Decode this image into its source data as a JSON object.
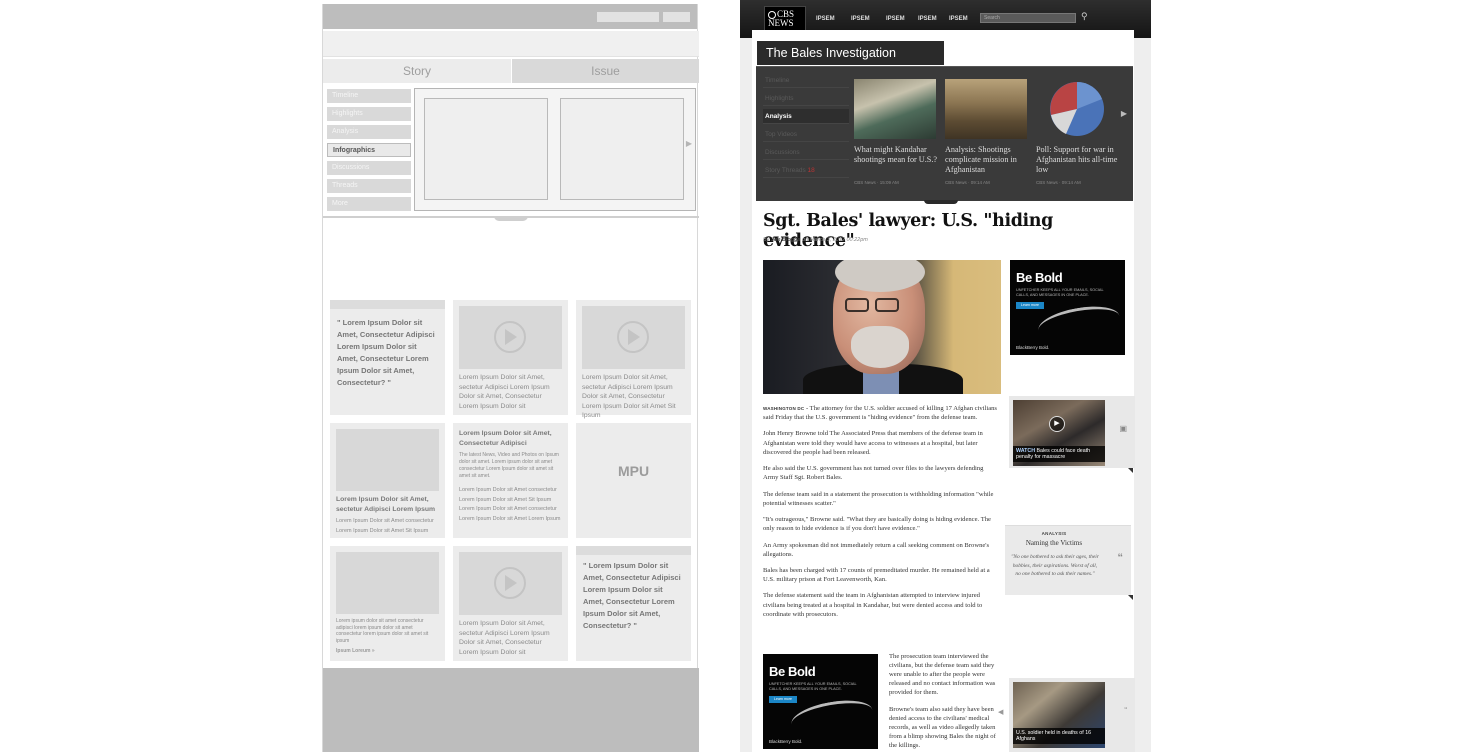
{
  "wireframe": {
    "tabs": [
      "Story",
      "Issue"
    ],
    "nav_items": [
      "Timeline",
      "Highlights",
      "Analysis",
      "Infographics",
      "Discussions",
      "Threads",
      "More"
    ],
    "active_nav": "Infographics",
    "cells": {
      "quote1": "\" Lorem Ipsum Dolor sit Amet, Consectetur Adipisci Lorem Ipsum Dolor sit Amet, Consectetur Lorem Ipsum Dolor sit Amet, Consectetur? \"",
      "video1_text": "Lorem Ipsum Dolor sit Amet, sectetur Adipisci Lorem Ipsum Dolor sit Amet, Consectetur Lorem Ipsum Dolor sit",
      "video2_text": "Lorem Ipsum Dolor sit Amet, sectetur Adipisci Lorem Ipsum Dolor sit Amet, Consectetur Lorem Ipsum Dolor sit Amet Sit Ipsum",
      "image1_title": "Lorem Ipsum Dolor sit Amet, sectetur Adipisci Lorem Ipsum",
      "image1_text": "Lorem Ipsum Dolor sit Amet consectetur Lorem Ipsum Dolor sit Amet Sit Ipsum",
      "article_title": "Lorem Ipsum Dolor sit Amet, Consectetur Adipisci",
      "article_intro": "The latest News, Video and Photos on Ipsum dolor sit amet. Lorem ipsum dolor sit amet consectetur Lorem Ipsum dolor sit amet sit amet sit amet.",
      "article_list": "Lorem Ipsum Dolor sit Amet consectetur Lorem Ipsum Dolor sit Amet Sit Ipsum Lorem Ipsum Dolor sit Amet consectetur Lorem Ipsum Dolor sit Amet Lorem Ipsum",
      "mpu": "MPU",
      "image2_text": "Lorem ipsum dolor sit amet consectetur adipisci lorem ipsum dolor sit amet consectetur lorem ipsum dolor sit amet sit ipsum",
      "image2_more": "Ipsum Loreum »",
      "video3_text": "Lorem Ipsum Dolor sit Amet, sectetur Adipisci Lorem Ipsum Dolor sit Amet, Consectetur Lorem Ipsum Dolor sit",
      "quote2": "\" Lorem Ipsum Dolor sit Amet, Consectetur Adipisci Lorem Ipsum Dolor sit Amet, Consectetur Lorem Ipsum Dolor sit Amet, Consectetur? \""
    }
  },
  "mockup": {
    "logo": "CBS NEWS",
    "nav": [
      "IPSEM",
      "IPSEM",
      "IPSEM",
      "IPSEM",
      "IPSEM"
    ],
    "search_placeholder": "Search",
    "banner_title": "The Bales Investigation",
    "dark_nav": [
      "Timeline",
      "Highlights",
      "Analysis",
      "Top Videos",
      "Discussions",
      "Story Threads"
    ],
    "dark_nav_badge": "18",
    "active_dark_nav": "Analysis",
    "thumbs": [
      {
        "caption": "What might Kandahar shootings mean for U.S.?",
        "meta": "CBS News · 15:09 AM"
      },
      {
        "caption": "Analysis: Shootings complicate mission in Afghanistan",
        "meta": "CBS News · 09:14 AM"
      },
      {
        "caption": "Poll: Support for war in Afghanistan hits all-time low",
        "meta": "CBS News · 09:14 AM"
      }
    ],
    "headline": "Sgt. Bales' lawyer: U.S. \"hiding evidence\"",
    "byline_by": "By",
    "byline_author": "Joe Bloggs",
    "byline_rest": "on March 3, 2012 00:22pm",
    "ad": {
      "title": "Be Bold",
      "sub": "UNFETCHER KEEPS ALL YOUR EMAILS, SOCIAL CALLS, AND MESSAGES IN ONE PLACE.",
      "button": "Learn more",
      "brand": "BlackBerry Bold."
    },
    "dateline": "WASHINGTON DC",
    "paragraphs": [
      "- The attorney for the U.S. soldier accused of killing 17 Afghan civilians said Friday that the U.S. government is \"hiding evidence\" from the defense team.",
      "John Henry Browne told The Associated Press that members of the defense team in Afghanistan were told they would have access to witnesses at a hospital, but later discovered the people had been released.",
      "He also said the U.S. government has not turned over files to the lawyers defending Army Staff Sgt. Robert Bales.",
      "The defense team said in a statement the prosecution is withholding information \"while potential witnesses scatter.\"",
      "\"It's outrageous,\" Browne said. \"What they are basically doing is hiding evidence. The only reason to hide evidence is if you don't have evidence.\"",
      "An Army spokesman did not immediately return a call seeking comment on Browne's allegations.",
      "Bales has been charged with 17 counts of premeditated murder. He remained held at a U.S. military prison at Fort Leavenworth, Kan.",
      "The defense statement said the team in Afghanistan attempted to interview injured civilians being treated at a hospital in Kandahar, but were denied access and told to coordinate with prosecutors."
    ],
    "paragraphs2": [
      "The prosecution team interviewed the civilians, but the defense team said they were unable to after the people were released and no contact information was provided for them.",
      "Browne's team also said they have been denied access to the civilians' medical records, as well as video allegedly taken from a blimp showing Bales the night of the killings."
    ],
    "side1": {
      "watch": "WATCH",
      "caption": "Bales could face death penalty for massacre"
    },
    "analysis": {
      "kicker": "ANALYSIS",
      "title": "Naming the Victims",
      "quote": "\"No one bothered to ask their ages, their hobbies, their aspirations. Worst of all, no one bothered to ask their names.\""
    },
    "side2": {
      "caption": "U.S. soldier held in deaths of 16 Afghans"
    }
  }
}
